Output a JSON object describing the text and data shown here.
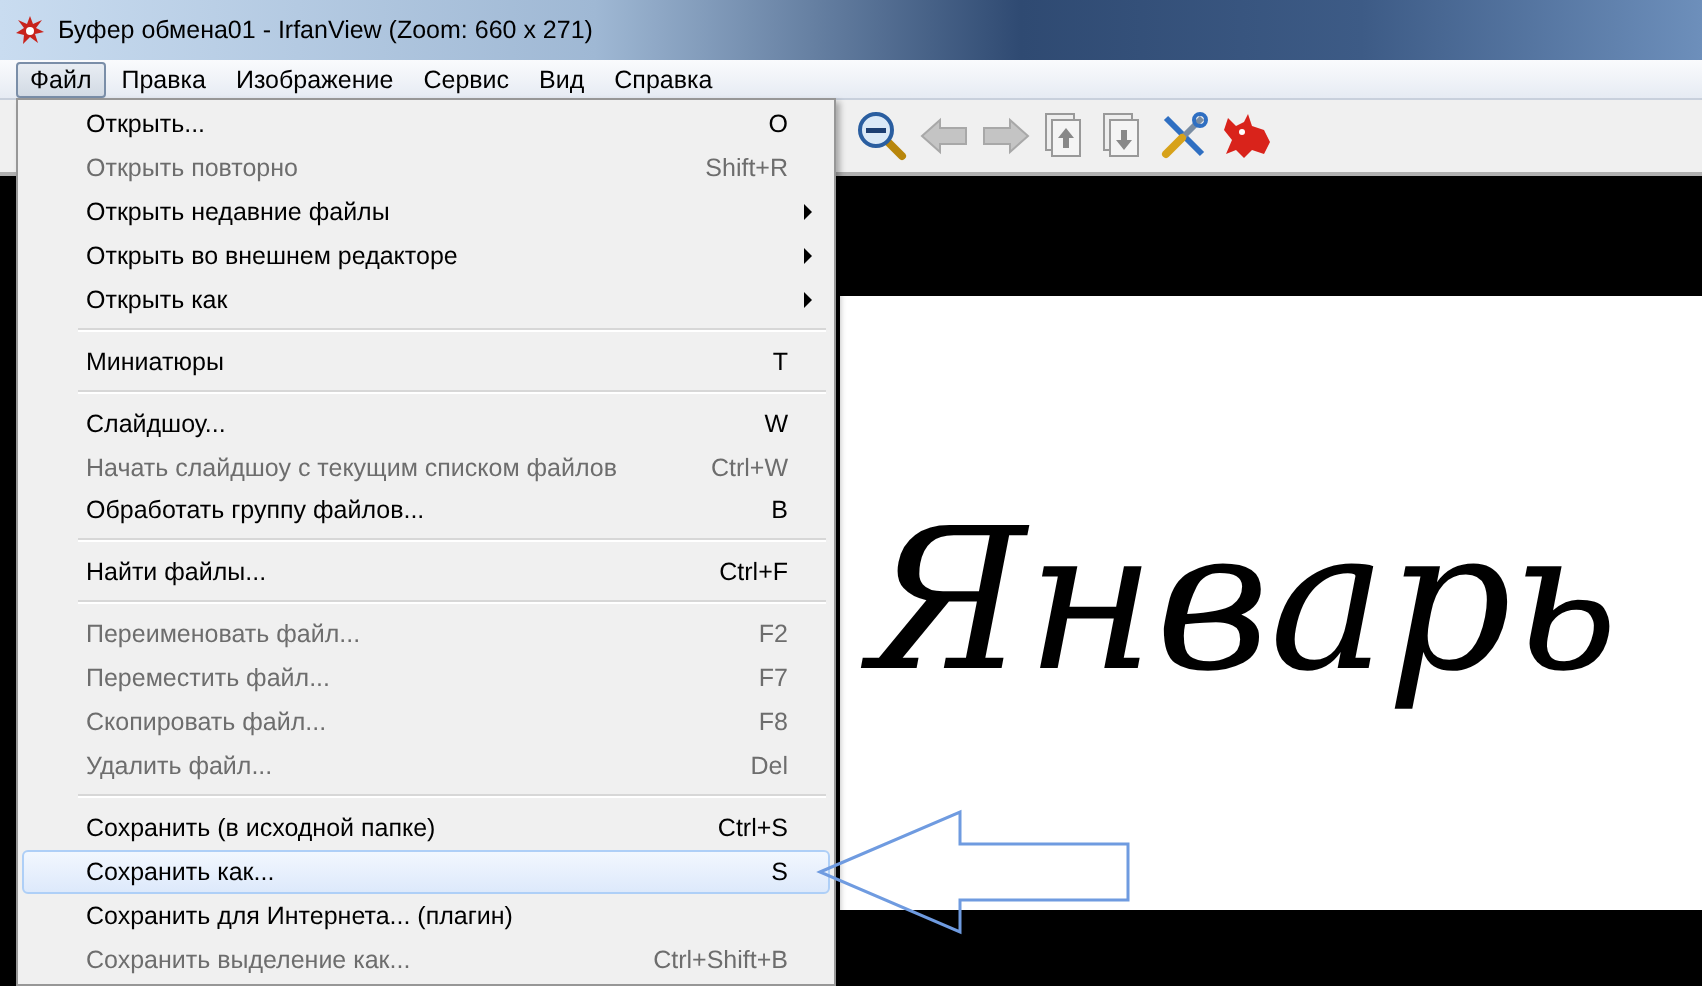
{
  "window": {
    "title": "Буфер обмена01 - IrfanView (Zoom: 660 x 271)"
  },
  "menubar": [
    {
      "label": "Файл",
      "selected": true
    },
    {
      "label": "Правка",
      "selected": false
    },
    {
      "label": "Изображение",
      "selected": false
    },
    {
      "label": "Сервис",
      "selected": false
    },
    {
      "label": "Вид",
      "selected": false
    },
    {
      "label": "Справка",
      "selected": false
    }
  ],
  "image": {
    "text": "Январь"
  },
  "menu": {
    "items": [
      {
        "kind": "item",
        "label": "Открыть...",
        "shortcut": "O",
        "disabled": false,
        "submenu": false,
        "selected": false
      },
      {
        "kind": "item",
        "label": "Открыть повторно",
        "shortcut": "Shift+R",
        "disabled": true,
        "submenu": false,
        "selected": false
      },
      {
        "kind": "item",
        "label": "Открыть недавние файлы",
        "disabled": false,
        "submenu": true,
        "selected": false
      },
      {
        "kind": "item",
        "label": "Открыть во внешнем редакторе",
        "disabled": false,
        "submenu": true,
        "selected": false
      },
      {
        "kind": "item",
        "label": "Открыть как",
        "disabled": false,
        "submenu": true,
        "selected": false
      },
      {
        "kind": "separator"
      },
      {
        "kind": "item",
        "label": "Миниатюры",
        "shortcut": "T",
        "disabled": false,
        "submenu": false,
        "selected": false
      },
      {
        "kind": "separator"
      },
      {
        "kind": "item",
        "label": "Слайдшоу...",
        "shortcut": "W",
        "disabled": false,
        "submenu": false,
        "selected": false
      },
      {
        "kind": "item",
        "label": "Начать слайдшоу с текущим списком файлов",
        "shortcut": "Ctrl+W",
        "disabled": true,
        "submenu": false,
        "selected": false
      },
      {
        "kind": "item",
        "label": "Обработать группу файлов...",
        "shortcut": "B",
        "disabled": false,
        "submenu": false,
        "selected": false
      },
      {
        "kind": "separator"
      },
      {
        "kind": "item",
        "label": "Найти файлы...",
        "shortcut": "Ctrl+F",
        "disabled": false,
        "submenu": false,
        "selected": false
      },
      {
        "kind": "separator"
      },
      {
        "kind": "item",
        "label": "Переименовать файл...",
        "shortcut": "F2",
        "disabled": true,
        "submenu": false,
        "selected": false
      },
      {
        "kind": "item",
        "label": "Переместить файл...",
        "shortcut": "F7",
        "disabled": true,
        "submenu": false,
        "selected": false
      },
      {
        "kind": "item",
        "label": "Скопировать файл...",
        "shortcut": "F8",
        "disabled": true,
        "submenu": false,
        "selected": false
      },
      {
        "kind": "item",
        "label": "Удалить файл...",
        "shortcut": "Del",
        "disabled": true,
        "submenu": false,
        "selected": false
      },
      {
        "kind": "separator"
      },
      {
        "kind": "item",
        "label": "Сохранить (в исходной папке)",
        "shortcut": "Ctrl+S",
        "disabled": false,
        "submenu": false,
        "selected": false
      },
      {
        "kind": "item",
        "label": "Сохранить как...",
        "shortcut": "S",
        "disabled": false,
        "submenu": false,
        "selected": true
      },
      {
        "kind": "item",
        "label": "Сохранить для Интернета... (плагин)",
        "disabled": false,
        "submenu": false,
        "selected": false
      },
      {
        "kind": "item",
        "label": "Сохранить выделение как...",
        "shortcut": "Ctrl+Shift+B",
        "disabled": true,
        "submenu": false,
        "selected": false
      }
    ]
  }
}
